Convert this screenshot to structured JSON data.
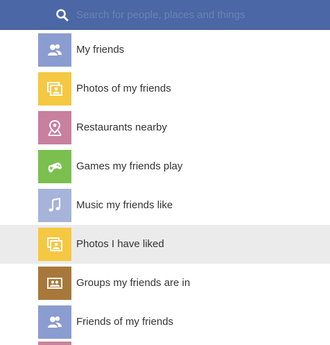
{
  "search": {
    "placeholder": "Search for people, places and things",
    "icon": "search-icon"
  },
  "suggestions": [
    {
      "label": "My friends",
      "icon": "friends-icon",
      "color": "#8b9cd0",
      "highlighted": false
    },
    {
      "label": "Photos of my friends",
      "icon": "photos-icon",
      "color": "#f5c842",
      "highlighted": false
    },
    {
      "label": "Restaurants nearby",
      "icon": "map-pin-icon",
      "color": "#c97f9e",
      "highlighted": false
    },
    {
      "label": "Games my friends play",
      "icon": "game-controller-icon",
      "color": "#7bbf4f",
      "highlighted": false
    },
    {
      "label": "Music my friends like",
      "icon": "music-note-icon",
      "color": "#a6b4da",
      "highlighted": false
    },
    {
      "label": "Photos I have liked",
      "icon": "photos-icon",
      "color": "#f5c842",
      "highlighted": true
    },
    {
      "label": "Groups my friends are in",
      "icon": "groups-icon",
      "color": "#a8783a",
      "highlighted": false
    },
    {
      "label": "Friends of my friends",
      "icon": "friends-icon",
      "color": "#8b9cd0",
      "highlighted": false
    }
  ],
  "colors": {
    "header_bg": "#4b67a5",
    "highlight_bg": "#ebebeb",
    "text": "#333333"
  }
}
